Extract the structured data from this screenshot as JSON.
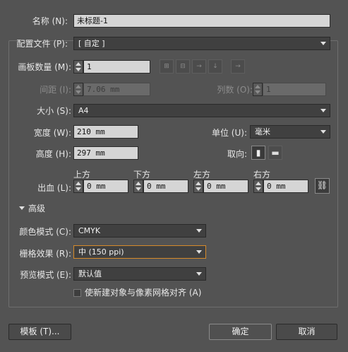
{
  "name": {
    "label": "名称 (N):",
    "value": "未标题-1"
  },
  "profile": {
    "label": "配置文件 (P):",
    "value": "[ 自定 ]"
  },
  "artboards": {
    "label": "画板数量 (M):",
    "value": "1"
  },
  "spacing": {
    "label": "间距 (I):",
    "value": "7.06 mm"
  },
  "columns": {
    "label": "列数 (O):",
    "value": "1"
  },
  "size": {
    "label": "大小 (S):",
    "value": "A4"
  },
  "width": {
    "label": "宽度 (W):",
    "value": "210 mm"
  },
  "units": {
    "label": "单位 (U):",
    "value": "毫米"
  },
  "height": {
    "label": "高度 (H):",
    "value": "297 mm"
  },
  "orientation": {
    "label": "取向:"
  },
  "bleed": {
    "label": "出血 (L):",
    "top": {
      "label": "上方",
      "value": "0 mm"
    },
    "bottom": {
      "label": "下方",
      "value": "0 mm"
    },
    "left": {
      "label": "左方",
      "value": "0 mm"
    },
    "right": {
      "label": "右方",
      "value": "0 mm"
    }
  },
  "advanced": {
    "label": "高级"
  },
  "color_mode": {
    "label": "颜色模式 (C):",
    "value": "CMYK"
  },
  "raster_effects": {
    "label": "栅格效果 (R):",
    "value": "中 (150 ppi)"
  },
  "preview_mode": {
    "label": "预览模式 (E):",
    "value": "默认值"
  },
  "align_pixel": {
    "label": "使新建对象与像素网格对齐 (A)",
    "checked": false
  },
  "buttons": {
    "templates": "模板 (T)...",
    "ok": "确定",
    "cancel": "取消"
  },
  "colors": {
    "background": "#535353",
    "highlight_border": "#d58a2a",
    "field_bg": "#d5d5d5"
  }
}
